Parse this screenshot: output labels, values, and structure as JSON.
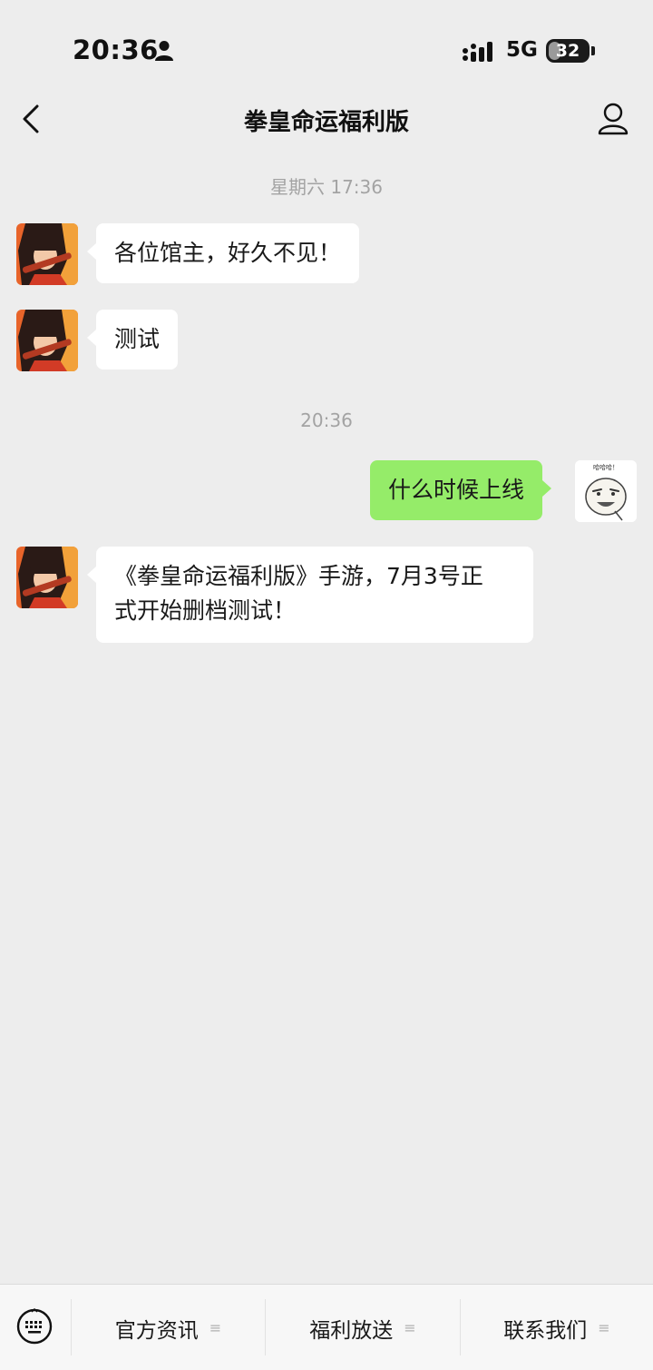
{
  "status_bar": {
    "time": "20:36",
    "network": "5G",
    "battery": "32",
    "battery_level": 0.32
  },
  "nav": {
    "title": "拳皇命运福利版"
  },
  "chat": {
    "timestamp_1": "星期六 17:36",
    "message_1": "各位馆主，好久不见！",
    "message_2": "测试",
    "timestamp_2": "20:36",
    "message_3": "什么时候上线",
    "message_4_line_1": "《拳皇命运福利版》手游，7月3号正",
    "message_4_line_2": "式开始删档测试！",
    "sticker_text": "哈哈哈！"
  },
  "bottom_menu": {
    "items": [
      {
        "label": "官方资讯"
      },
      {
        "label": "福利放送"
      },
      {
        "label": "联系我们"
      }
    ]
  },
  "colors": {
    "background": "#ededed",
    "bubble_incoming": "#ffffff",
    "bubble_outgoing": "#95ec69",
    "timestamp": "#a3a3a3"
  }
}
